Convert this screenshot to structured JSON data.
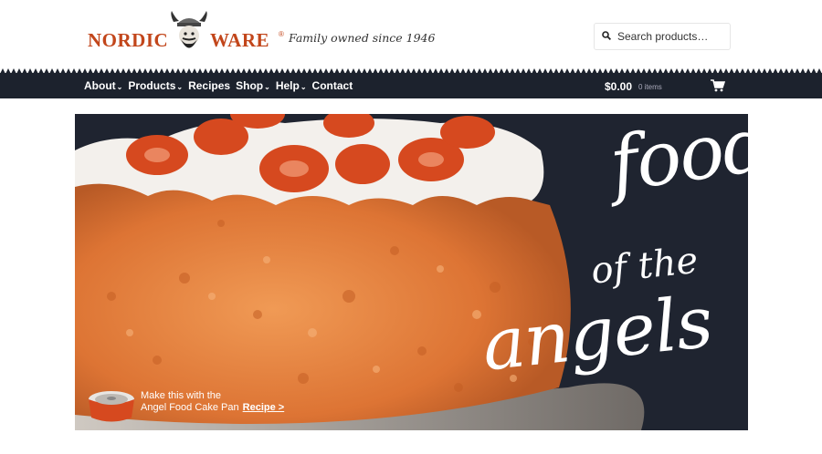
{
  "header": {
    "brand_left": "NORDIC",
    "brand_right": "WARE",
    "brand_mark": "®",
    "tagline": "Family owned since 1946",
    "search": {
      "placeholder": "Search products…",
      "icon": "search-icon"
    }
  },
  "nav": {
    "items": [
      {
        "label": "About",
        "dropdown": true
      },
      {
        "label": "Products",
        "dropdown": true
      },
      {
        "label": "Recipes",
        "dropdown": false
      },
      {
        "label": "Shop",
        "dropdown": true
      },
      {
        "label": "Help",
        "dropdown": true
      },
      {
        "label": "Contact",
        "dropdown": false
      }
    ],
    "caret": "⌄",
    "cart": {
      "total": "$0.00",
      "count": "0 items",
      "icon": "cart-icon"
    }
  },
  "hero": {
    "title_1": "food",
    "title_2": "of the",
    "title_3": "angels",
    "promo_line_1": "Make this with the",
    "promo_line_2": "Angel Food Cake Pan",
    "recipe_link": "Recipe >"
  },
  "colors": {
    "brand": "#c2461b",
    "nav_bg": "#1c222d",
    "hero_bg": "#1f2430",
    "cake": "#e07a3c",
    "cream": "#f3f0ec",
    "strawberry": "#d6491f"
  }
}
